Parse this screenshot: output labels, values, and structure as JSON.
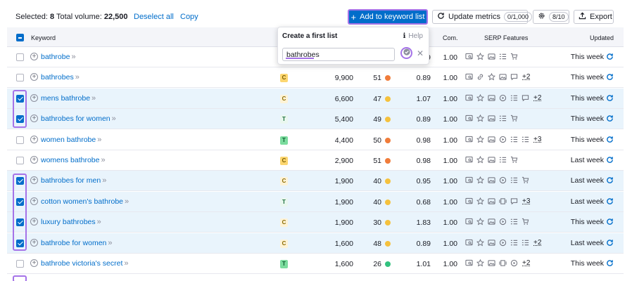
{
  "toolbar": {
    "selected_label": "Selected:",
    "selected_count": "8",
    "total_label": "Total volume:",
    "total_value": "22,500",
    "deselect": "Deselect all",
    "copy": "Copy",
    "add_button": "Add to keyword list",
    "update_metrics": "Update metrics",
    "update_badge": "0/1,000",
    "settings_badge": "8/10",
    "export": "Export"
  },
  "headers": {
    "keyword": "Keyword",
    "com": "Com.",
    "serp": "SERP Features",
    "updated": "Updated"
  },
  "popup": {
    "title": "Create a first list",
    "help": "Help",
    "input_value": "bathrobes"
  },
  "colors": {
    "accent": "#006dca",
    "highlight": "#a573e8",
    "kd_orange": "#f07c3a",
    "kd_yellow": "#f5c13d",
    "kd_green": "#33c27f"
  },
  "rows": [
    {
      "keyword": "bathrobe",
      "intent": "",
      "volume": "",
      "kd": "",
      "kd_color": "",
      "cpc": "9",
      "com": "1.00",
      "serp_more": "",
      "updated": "This week",
      "checked": false
    },
    {
      "keyword": "bathrobes",
      "intent": "C",
      "volume": "9,900",
      "kd": "51",
      "kd_color": "#f07c3a",
      "cpc": "0.89",
      "com": "1.00",
      "serp_more": "+2",
      "updated": "This week",
      "checked": false
    },
    {
      "keyword": "mens bathrobe",
      "intent": "C",
      "volume": "6,600",
      "kd": "47",
      "kd_color": "#f5c13d",
      "cpc": "1.07",
      "com": "1.00",
      "serp_more": "+2",
      "updated": "This week",
      "checked": true
    },
    {
      "keyword": "bathrobes for women",
      "intent": "T",
      "volume": "5,400",
      "kd": "49",
      "kd_color": "#f5c13d",
      "cpc": "0.89",
      "com": "1.00",
      "serp_more": "",
      "updated": "This week",
      "checked": true
    },
    {
      "keyword": "women bathrobe",
      "intent": "T",
      "volume": "4,400",
      "kd": "50",
      "kd_color": "#f07c3a",
      "cpc": "0.98",
      "com": "1.00",
      "serp_more": "+3",
      "updated": "This week",
      "checked": false
    },
    {
      "keyword": "womens bathrobe",
      "intent": "C",
      "volume": "2,900",
      "kd": "51",
      "kd_color": "#f07c3a",
      "cpc": "0.98",
      "com": "1.00",
      "serp_more": "",
      "updated": "Last week",
      "checked": false
    },
    {
      "keyword": "bathrobes for men",
      "intent": "C",
      "volume": "1,900",
      "kd": "40",
      "kd_color": "#f5c13d",
      "cpc": "0.95",
      "com": "1.00",
      "serp_more": "",
      "updated": "Last week",
      "checked": true
    },
    {
      "keyword": "cotton women's bathrobe",
      "intent": "T",
      "volume": "1,900",
      "kd": "40",
      "kd_color": "#f5c13d",
      "cpc": "0.68",
      "com": "1.00",
      "serp_more": "+3",
      "updated": "Last week",
      "checked": true
    },
    {
      "keyword": "luxury bathrobes",
      "intent": "C",
      "volume": "1,900",
      "kd": "30",
      "kd_color": "#f5c13d",
      "cpc": "1.83",
      "com": "1.00",
      "serp_more": "",
      "updated": "This week",
      "checked": true
    },
    {
      "keyword": "bathrobe for women",
      "intent": "C",
      "volume": "1,600",
      "kd": "48",
      "kd_color": "#f5c13d",
      "cpc": "0.89",
      "com": "1.00",
      "serp_more": "+2",
      "updated": "Last week",
      "checked": true
    },
    {
      "keyword": "bathrobe victoria's secret",
      "intent": "T",
      "volume": "1,600",
      "kd": "26",
      "kd_color": "#33c27f",
      "cpc": "1.01",
      "com": "1.00",
      "serp_more": "+2",
      "updated": "This week",
      "checked": false
    }
  ]
}
